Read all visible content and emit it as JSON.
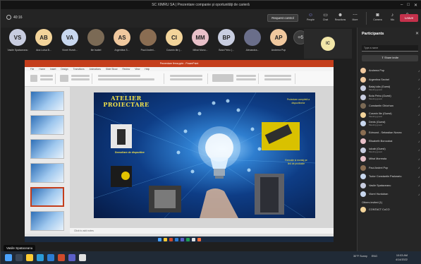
{
  "window": {
    "title": "SC XIMRU SA | Prezentare companie și oportunități de carieră"
  },
  "toolbar": {
    "timer": "40:16",
    "request_control": "Request control",
    "items": [
      {
        "label": "People",
        "icon": "people-icon"
      },
      {
        "label": "Chat",
        "icon": "chat-icon"
      },
      {
        "label": "Reactions",
        "icon": "reactions-icon"
      },
      {
        "label": "More",
        "icon": "more-icon"
      },
      {
        "label": "Camera",
        "icon": "camera-icon"
      },
      {
        "label": "Mic",
        "icon": "mic-icon"
      },
      {
        "label": "Share",
        "icon": "share-icon"
      }
    ],
    "leave": "Leave"
  },
  "avatars": [
    {
      "initials": "VS",
      "name": "Vasile Spataceanu",
      "color": "#c8cde0"
    },
    {
      "initials": "AB",
      "name": "Ana Luisa B...",
      "color": "#f3d49a"
    },
    {
      "initials": "VA",
      "name": "Viorel Hursh...",
      "color": "#c8d7ee"
    },
    {
      "initials": "",
      "name": "Ilie Isabel",
      "color": "#7b6a55"
    },
    {
      "initials": "AS",
      "name": "Argentina S...",
      "color": "#f0c89e"
    },
    {
      "initials": "",
      "name": "Paul Andrei...",
      "color": "#8a6d52"
    },
    {
      "initials": "CI",
      "name": "Cosmin Ilie (...",
      "color": "#f3d49a"
    },
    {
      "initials": "MM",
      "name": "Mihai Mono...",
      "color": "#e8c0c8"
    },
    {
      "initials": "BP",
      "name": "Bota Petru (...",
      "color": "#c8cde0"
    },
    {
      "initials": "",
      "name": "Alexandra...",
      "color": "#6a6e8a"
    },
    {
      "initials": "AP",
      "name": "Andreea Pop",
      "color": "#f0c89e"
    }
  ],
  "more_count": "+6",
  "ic_tile": {
    "initials": "IC"
  },
  "presentation": {
    "window_title": "Prezentare firma.pptx - PowerPoint",
    "menu": [
      "File",
      "Home",
      "Insert",
      "Design",
      "Transitions",
      "Animations",
      "Slide Show",
      "Review",
      "View",
      "Help"
    ],
    "notes_placeholder": "Click to add notes",
    "slide": {
      "title": "ATELIER PROIECTARE",
      "subtitle": "Dezvoltare de dispozitive",
      "right_text": "Proiectare completă a dispozitivelor",
      "right_text2": "Execuție și montaj pe linii de producție"
    }
  },
  "presenter_tag": "Vasile Spataceanu",
  "panel": {
    "title": "Participants",
    "search_placeholder": "Type a name",
    "share_invite": "Share invite",
    "participants": [
      {
        "name": "Andreea Pop",
        "sub": "",
        "color": "#f0c89e"
      },
      {
        "name": "Argentina Sechel",
        "sub": "",
        "color": "#f0c89e"
      },
      {
        "name": "Balaj Iulia (Guest)",
        "sub": "Meeting guest",
        "color": "#c8cde0"
      },
      {
        "name": "Bota Petru (Guest)",
        "sub": "Meeting guest",
        "color": "#c8cde0"
      },
      {
        "name": "Constantin Ghiorhan",
        "sub": "",
        "color": "#7b6a55"
      },
      {
        "name": "Cosmin Ilie (Guest)",
        "sub": "Meeting guest",
        "color": "#f3d49a"
      },
      {
        "name": "Denis (Guest)",
        "sub": "Meeting guest",
        "color": "#c8d7ee"
      },
      {
        "name": "Edmund - Sebastian Novea",
        "sub": "",
        "color": "#8a6d52"
      },
      {
        "name": "Elisabeth Boroczkai",
        "sub": "",
        "color": "#e8c0c8"
      },
      {
        "name": "iulcab (Guest)",
        "sub": "Meeting guest",
        "color": "#c8cde0"
      },
      {
        "name": "Mihai Morreala",
        "sub": "",
        "color": "#e8c0c8"
      },
      {
        "name": "Paul Andrei Pop",
        "sub": "",
        "color": "#8a6d52"
      },
      {
        "name": "Tudor Constantin Padurariu",
        "sub": "",
        "color": "#c8d7ee"
      },
      {
        "name": "Vasile Spataceanu",
        "sub": "",
        "color": "#c8cde0"
      },
      {
        "name": "Viorel Hurduban",
        "sub": "",
        "color": "#c8d7ee"
      }
    ],
    "others_label": "Others invited (1)",
    "others": [
      {
        "name": "CONTACT CoCO",
        "color": "#f3d49a"
      }
    ]
  },
  "taskbar": {
    "weather": "30°F Sunny",
    "lang": "ENG",
    "time": "10:03 AM",
    "date": "4/14/2022"
  }
}
